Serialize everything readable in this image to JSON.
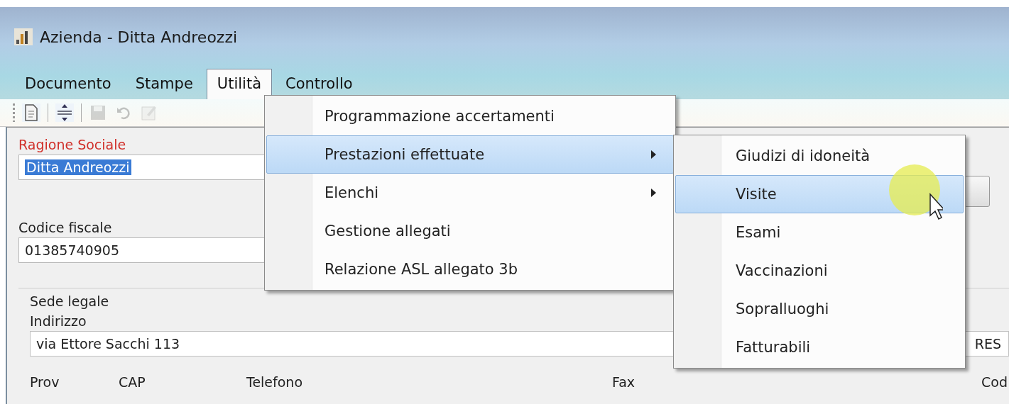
{
  "window": {
    "title": "Azienda - Ditta Andreozzi"
  },
  "menubar": [
    {
      "label": "Documento",
      "selected": false
    },
    {
      "label": "Stampe",
      "selected": false
    },
    {
      "label": "Utilità",
      "selected": true
    },
    {
      "label": "Controllo",
      "selected": false
    }
  ],
  "toolbar": [
    {
      "kind": "document",
      "disabled": false
    },
    {
      "kind": "separator"
    },
    {
      "kind": "resize",
      "disabled": false
    },
    {
      "kind": "separator"
    },
    {
      "kind": "save",
      "disabled": true
    },
    {
      "kind": "undo",
      "disabled": true
    },
    {
      "kind": "edit",
      "disabled": true
    }
  ],
  "form": {
    "company_label": "Ragione Sociale",
    "company_value": "Ditta Andreozzi",
    "company_value_selected": true,
    "tax_code_label": "Codice fiscale",
    "tax_code_value": "01385740905",
    "group_title": "Sede legale",
    "address_label": "Indirizzo",
    "address_value": "via Ettore Sacchi 113",
    "city_value": "RES",
    "columns": [
      "Prov",
      "CAP",
      "Telefono",
      "Fax",
      "Cod"
    ]
  },
  "menu": {
    "items": [
      {
        "label": "Programmazione accertamenti",
        "has_submenu": false,
        "selected": false
      },
      {
        "label": "Prestazioni effettuate",
        "has_submenu": true,
        "selected": true
      },
      {
        "label": "Elenchi",
        "has_submenu": true,
        "selected": false
      },
      {
        "label": "Gestione allegati",
        "has_submenu": false,
        "selected": false
      },
      {
        "label": "Relazione ASL allegato 3b",
        "has_submenu": false,
        "selected": false
      }
    ]
  },
  "submenu": {
    "items": [
      {
        "label": "Giudizi di idoneità",
        "selected": false
      },
      {
        "label": "Visite",
        "selected": true
      },
      {
        "label": "Esami",
        "selected": false
      },
      {
        "label": "Vaccinazioni",
        "selected": false
      },
      {
        "label": "Sopralluoghi",
        "selected": false
      },
      {
        "label": "Fatturabili",
        "selected": false
      }
    ]
  }
}
